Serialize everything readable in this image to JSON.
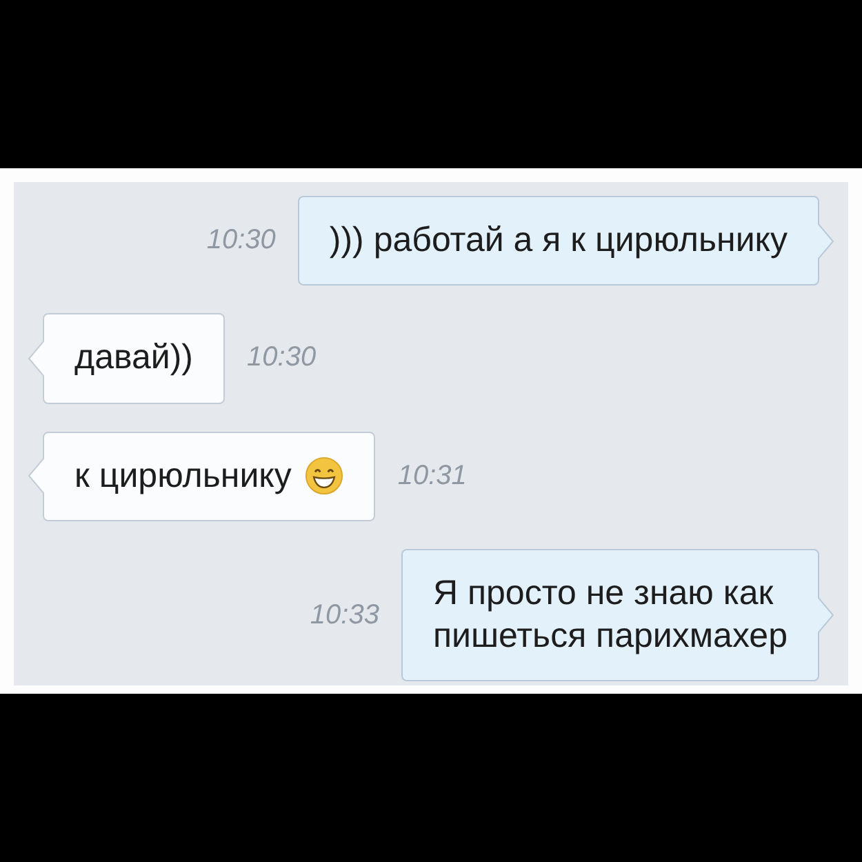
{
  "messages": [
    {
      "kind": "outgoing",
      "lines": [
        "))) работай а я к цирюльнику"
      ],
      "time": "10:30",
      "emoji": false
    },
    {
      "kind": "incoming",
      "lines": [
        "давай))"
      ],
      "time": "10:30",
      "emoji": false
    },
    {
      "kind": "incoming",
      "lines": [
        "к цирюльнику"
      ],
      "time": "10:31",
      "emoji": true
    },
    {
      "kind": "outgoing",
      "lines": [
        "Я просто не знаю как",
        "пишеться парихмахер"
      ],
      "time": "10:33",
      "emoji": false
    }
  ]
}
